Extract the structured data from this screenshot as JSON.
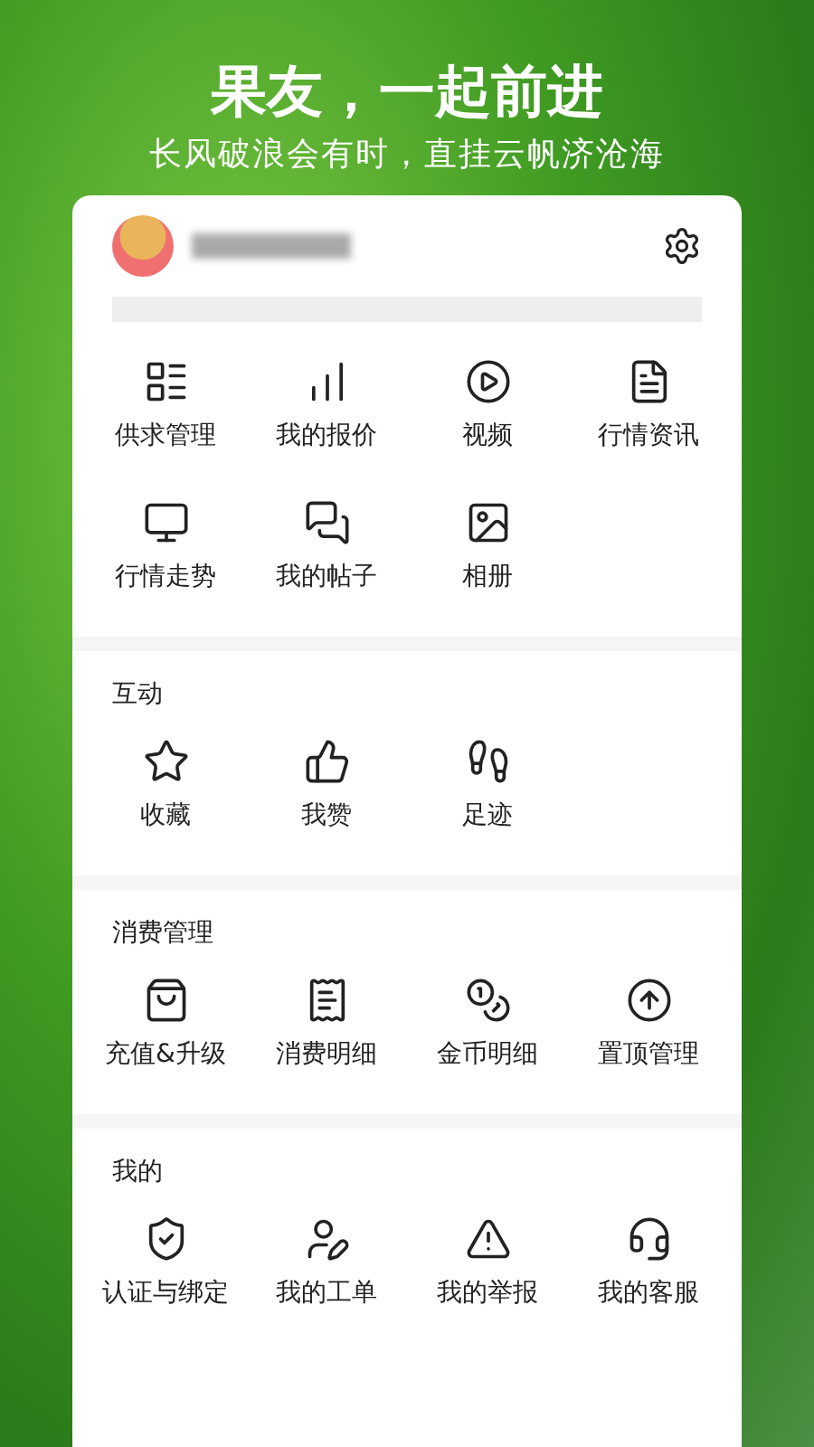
{
  "banner": {
    "title": "果友，一起前进",
    "subtitle": "长风破浪会有时，直挂云帆济沧海"
  },
  "sections": [
    {
      "items": [
        "供求管理",
        "我的报价",
        "视频",
        "行情资讯",
        "行情走势",
        "我的帖子",
        "相册"
      ]
    },
    {
      "title": "互动",
      "items": [
        "收藏",
        "我赞",
        "足迹"
      ]
    },
    {
      "title": "消费管理",
      "items": [
        "充值&升级",
        "消费明细",
        "金币明细",
        "置顶管理"
      ]
    },
    {
      "title": "我的",
      "items": [
        "认证与绑定",
        "我的工单",
        "我的举报",
        "我的客服"
      ]
    }
  ]
}
